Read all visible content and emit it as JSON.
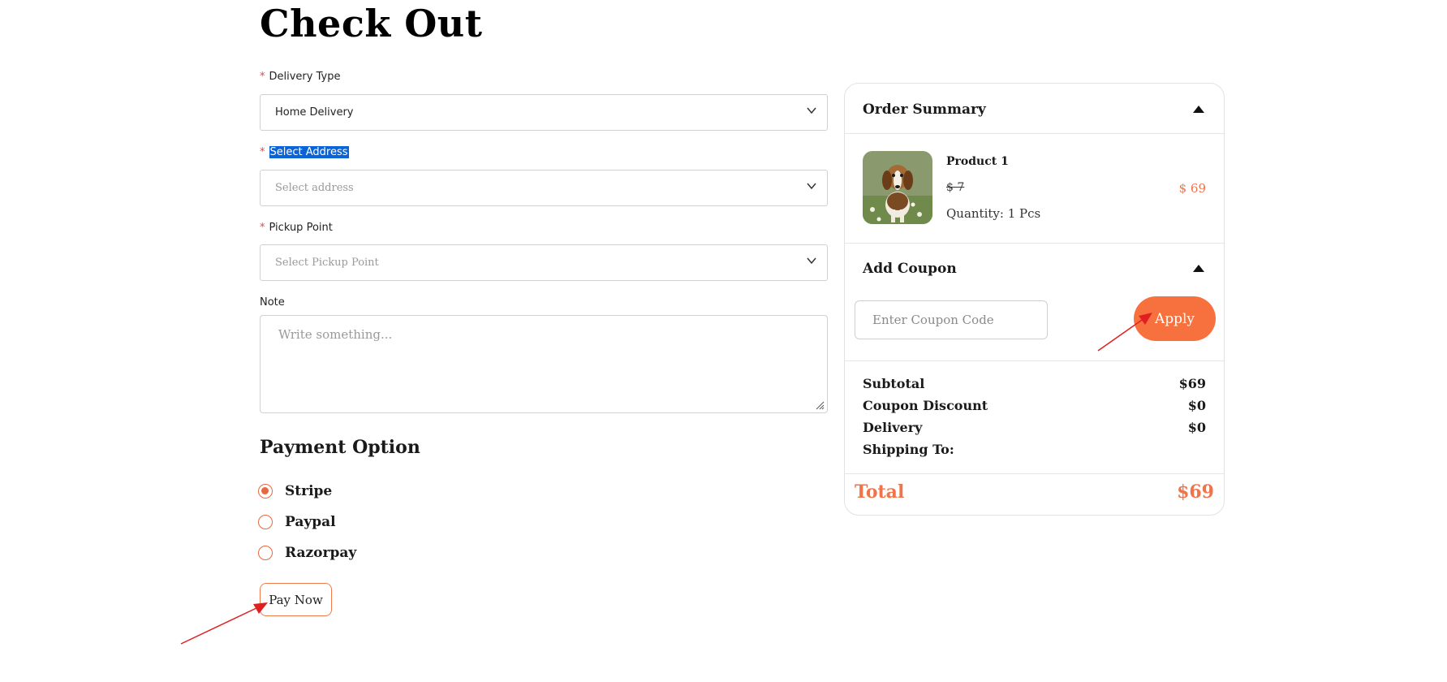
{
  "page": {
    "title": "Check Out"
  },
  "form": {
    "delivery_type": {
      "label": "Delivery Type",
      "value": "Home Delivery"
    },
    "address": {
      "label": "Select Address",
      "placeholder": "Select address"
    },
    "pickup_point": {
      "label": "Pickup Point",
      "placeholder": "Select Pickup Point"
    },
    "note": {
      "label": "Note",
      "placeholder": "Write something..."
    },
    "required_mark": "*"
  },
  "payment": {
    "title": "Payment Option",
    "options": [
      {
        "label": "Stripe",
        "selected": true
      },
      {
        "label": "Paypal",
        "selected": false
      },
      {
        "label": "Razorpay",
        "selected": false
      }
    ],
    "pay_button": "Pay Now"
  },
  "summary": {
    "title": "Order Summary",
    "product": {
      "name": "Product 1",
      "old_price": "$ 7",
      "price": "$ 69",
      "quantity": "Quantity: 1 Pcs"
    },
    "coupon": {
      "title": "Add Coupon",
      "placeholder": "Enter Coupon Code",
      "apply_label": "Apply"
    },
    "lines": [
      {
        "label": "Subtotal",
        "value": "$69"
      },
      {
        "label": "Coupon Discount",
        "value": "$0"
      },
      {
        "label": "Delivery",
        "value": "$0"
      },
      {
        "label": "Shipping To:",
        "value": ""
      }
    ],
    "total": {
      "label": "Total",
      "value": "$69"
    }
  },
  "colors": {
    "accent": "#f7713f",
    "required": "#e5484d",
    "selection_highlight": "#0a64d6",
    "annotation_arrow": "#e02020"
  },
  "icons": {
    "select_chevron": "chevron-down-icon",
    "section_toggle": "caret-up-icon",
    "textarea_resize": "resize-grip-icon",
    "product_image": "beagle-puppy-photo"
  }
}
